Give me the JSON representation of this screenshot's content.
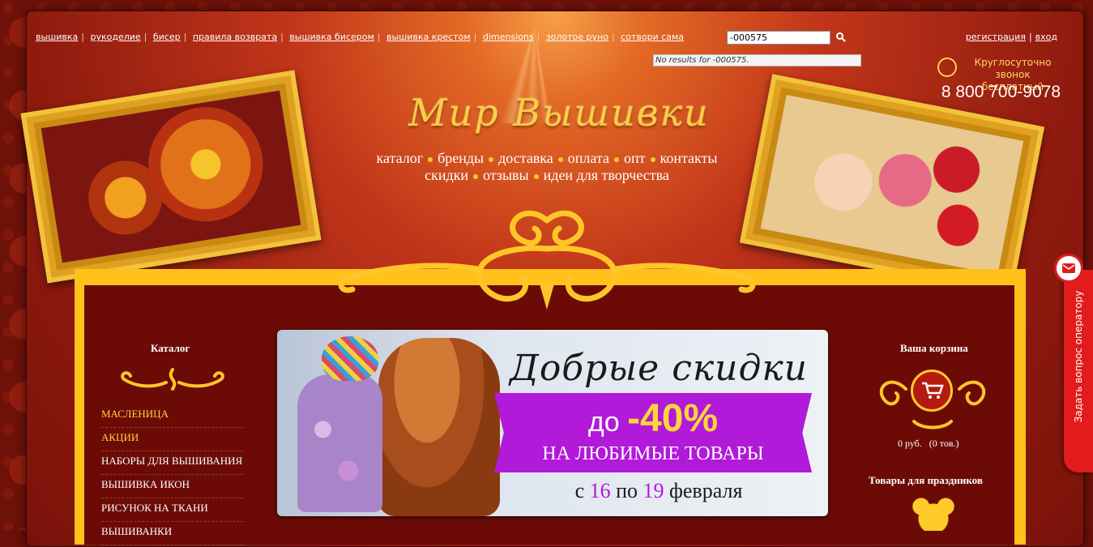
{
  "topnav": {
    "links": [
      "вышивка",
      "рукоделие",
      "бисер",
      "правила возврата",
      "вышивка бисером",
      "вышивка крестом",
      "dimensions",
      "золотое руно",
      "сотвори сама"
    ]
  },
  "search": {
    "value": "-000575",
    "no_results": "No results for -000575."
  },
  "auth": {
    "register": "регистрация",
    "login": "вход"
  },
  "phone": {
    "note": "Круглосуточно звонок бесплатный",
    "number": "8 800 700-9078"
  },
  "logo": {
    "text": "Мир Вышивки"
  },
  "mainnav": {
    "row1": [
      "каталог",
      "бренды",
      "доставка",
      "оплата",
      "опт",
      "контакты"
    ],
    "row2": [
      "скидки",
      "отзывы",
      "идеи для творчества"
    ]
  },
  "sidebar": {
    "title": "Каталог",
    "items": [
      "МАСЛЕНИЦА",
      "АКЦИИ",
      "НАБОРЫ ДЛЯ ВЫШИВАНИЯ",
      "ВЫШИВКА ИКОН",
      "РИСУНОК НА ТКАНИ",
      "ВЫШИВАНКИ"
    ]
  },
  "banner": {
    "title": "Добрые скидки",
    "pct_prefix": "до",
    "pct_value": "-40%",
    "subtitle": "НА ЛЮБИМЫЕ ТОВАРЫ",
    "date_from_label": "с",
    "date_from": "16",
    "date_to_label": "по",
    "date_to": "19",
    "date_month": "февраля"
  },
  "cart": {
    "title": "Ваша корзина",
    "sum": "0 руб.",
    "count": "(0 тов.)"
  },
  "holiday": {
    "title": "Товары для праздников"
  },
  "operator": {
    "label": "Задать вопрос оператору"
  },
  "colors": {
    "accent_gold": "#ffc11a",
    "bg_dark": "#6c0b06",
    "banner_purple": "#b01ad8",
    "operator_red": "#e21c1c"
  }
}
